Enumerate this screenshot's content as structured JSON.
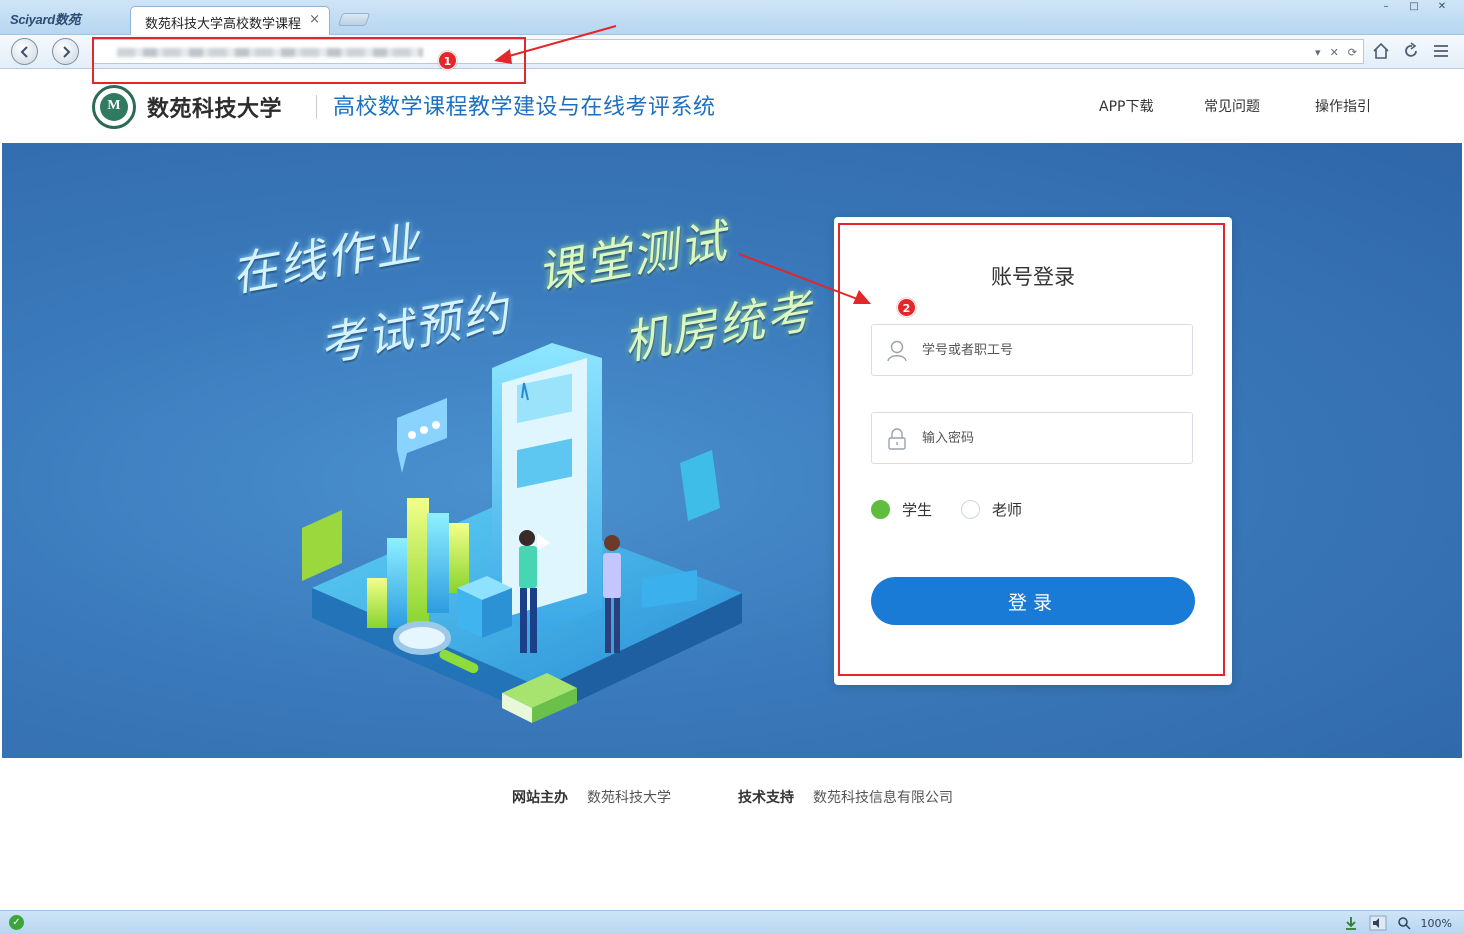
{
  "browser": {
    "brand": "Sciyard数苑",
    "tab_title": "数苑科技大学高校数学课程",
    "tab_close": "×",
    "window_buttons": [
      "–",
      "□",
      "✕"
    ],
    "address_tools": [
      "▾",
      "✕",
      "⟳"
    ],
    "zoom": "100%"
  },
  "annotations": {
    "one": "1",
    "two": "2"
  },
  "header": {
    "university": "数苑科技大学",
    "system_title": "高校数学课程教学建设与在线考评系统",
    "nav": [
      "APP下载",
      "常见问题",
      "操作指引"
    ]
  },
  "hero": {
    "slogans": [
      "在线作业",
      "考试预约",
      "课堂测试",
      "机房统考"
    ]
  },
  "login": {
    "title": "账号登录",
    "username_placeholder": "学号或者职工号",
    "password_placeholder": "输入密码",
    "roles": [
      "学生",
      "老师"
    ],
    "selected_role": "学生",
    "submit": "登录"
  },
  "footer": {
    "host_label": "网站主办",
    "host_value": "数苑科技大学",
    "support_label": "技术支持",
    "support_value": "数苑科技信息有限公司"
  },
  "colors": {
    "accent": "#1a7bd7",
    "title_blue": "#1d6fc2",
    "hero_blue": "#3a79bb",
    "annotation_red": "#e3262a",
    "radio_green": "#5fbd3f"
  }
}
